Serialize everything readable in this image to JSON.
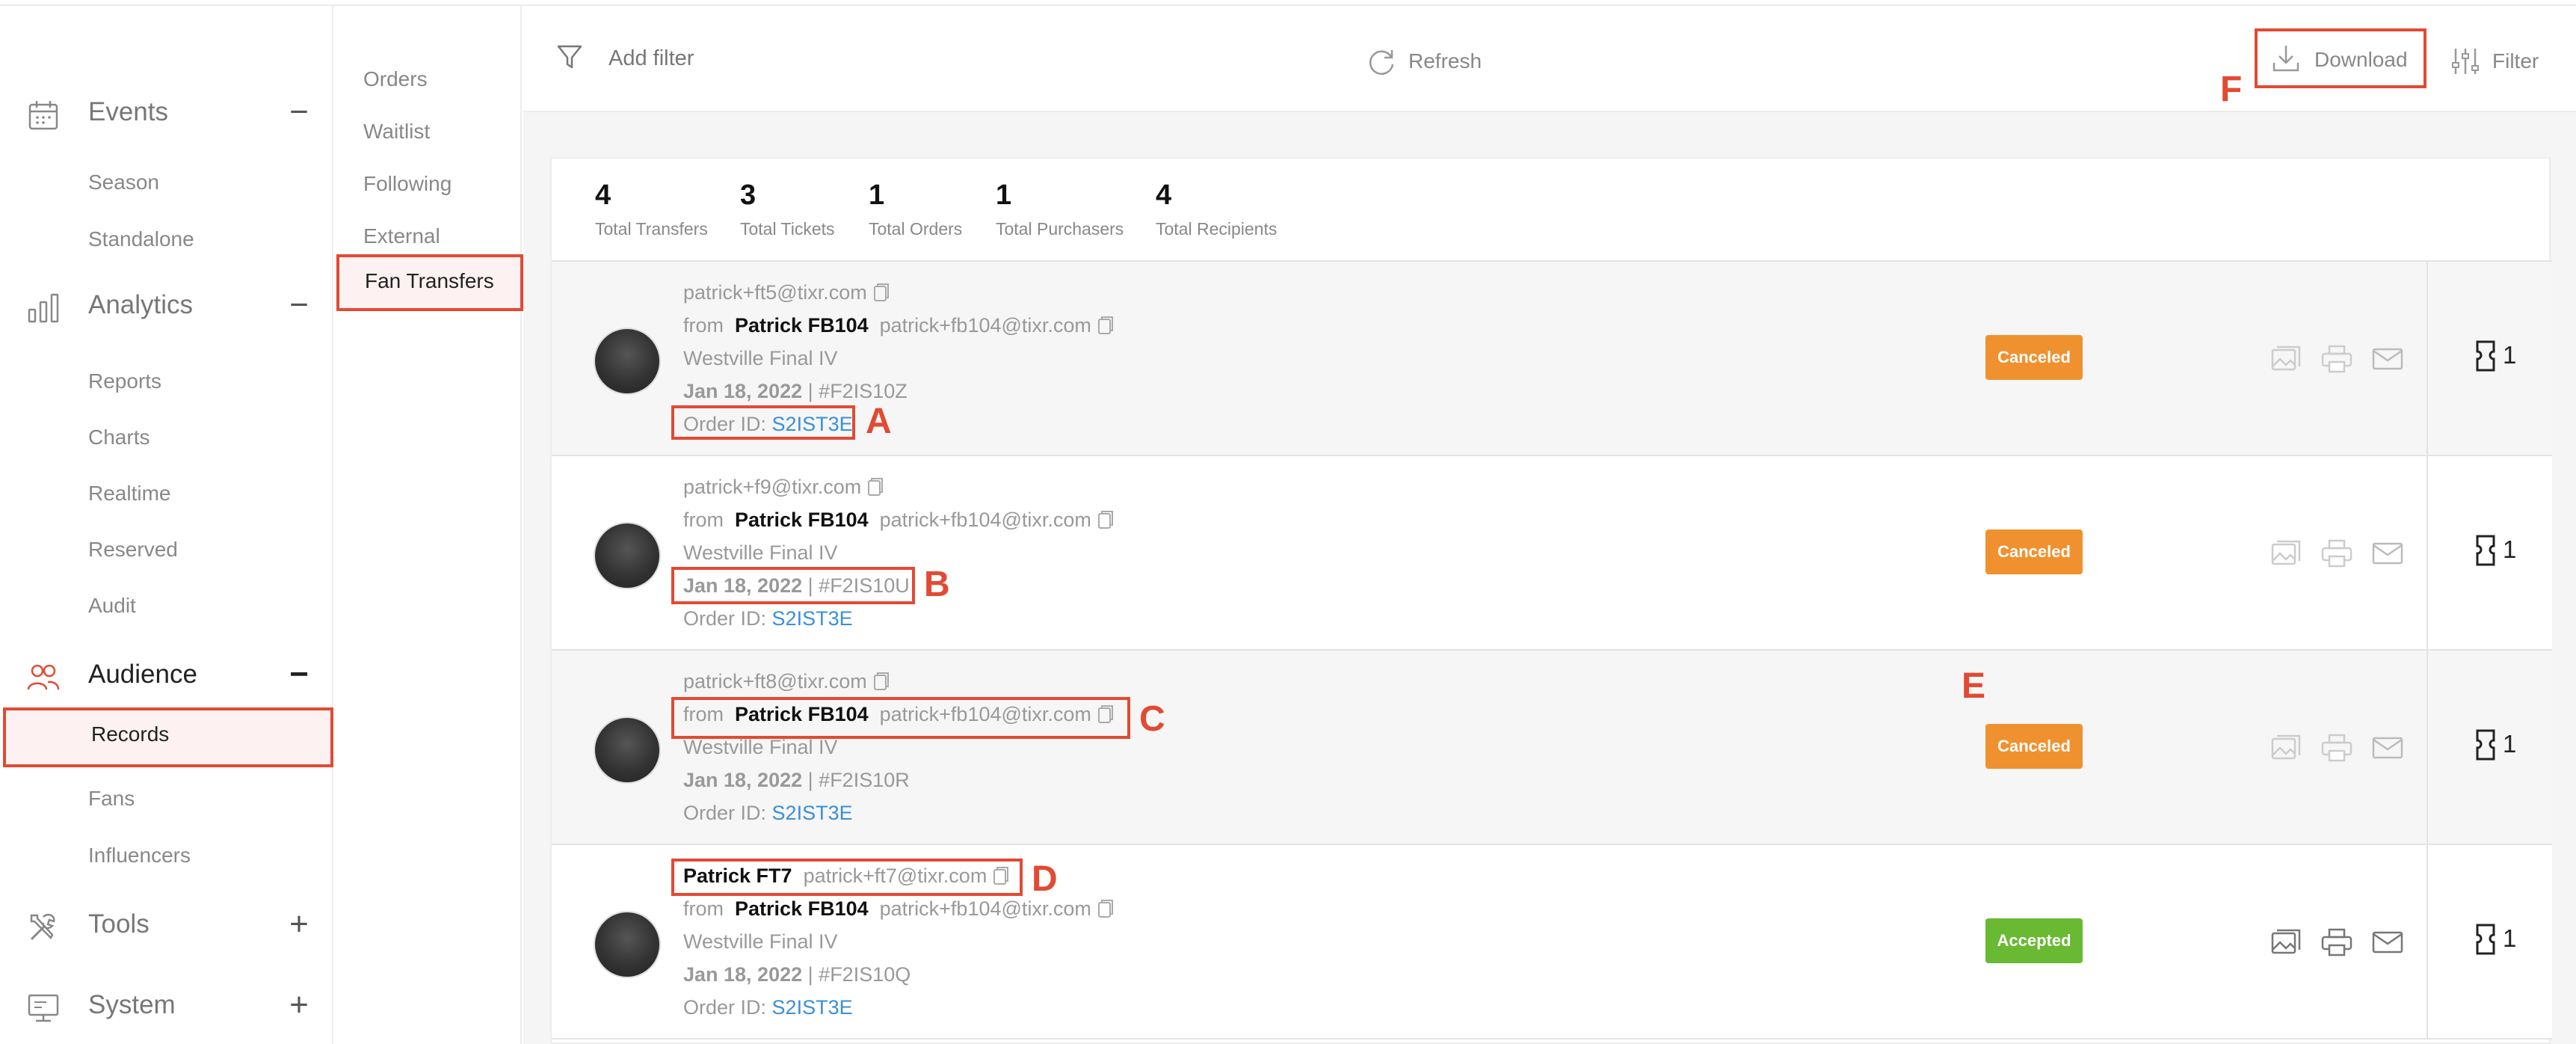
{
  "sidebar": {
    "sections": [
      {
        "label": "Events",
        "icon": "calendar-icon",
        "toggle": "−",
        "items": [
          "Season",
          "Standalone"
        ]
      },
      {
        "label": "Analytics",
        "icon": "bar-chart-icon",
        "toggle": "−",
        "items": [
          "Reports",
          "Charts",
          "Realtime",
          "Reserved",
          "Audit"
        ]
      },
      {
        "label": "Audience",
        "icon": "users-icon",
        "toggle": "−",
        "items": [
          "Records",
          "Fans",
          "Influencers"
        ]
      },
      {
        "label": "Tools",
        "icon": "tools-icon",
        "toggle": "+"
      },
      {
        "label": "System",
        "icon": "monitor-icon",
        "toggle": "+"
      }
    ],
    "selected_item": "Records"
  },
  "subnav": {
    "items": [
      "Orders",
      "Waitlist",
      "Following",
      "External",
      "Fan Transfers"
    ],
    "active": "Fan Transfers"
  },
  "toolbar": {
    "add_filter": "Add filter",
    "refresh": "Refresh",
    "download": "Download",
    "filter": "Filter"
  },
  "stats": [
    {
      "value": "4",
      "label": "Total Transfers"
    },
    {
      "value": "3",
      "label": "Total Tickets"
    },
    {
      "value": "1",
      "label": "Total Orders"
    },
    {
      "value": "1",
      "label": "Total Purchasers"
    },
    {
      "value": "4",
      "label": "Total Recipients"
    }
  ],
  "transfers": [
    {
      "recipient_name": "",
      "recipient_email": "patrick+ft5@tixr.com",
      "from_label": "from",
      "from_name": "Patrick FB104",
      "from_email": "patrick+fb104@tixr.com",
      "event": "Westville Final IV",
      "date": "Jan 18, 2022",
      "ref": "| #F2IS10Z",
      "order_label": "Order ID:",
      "order_id": "S2IST3E",
      "status": "Canceled",
      "tickets": "1"
    },
    {
      "recipient_name": "",
      "recipient_email": "patrick+f9@tixr.com",
      "from_label": "from",
      "from_name": "Patrick FB104",
      "from_email": "patrick+fb104@tixr.com",
      "event": "Westville Final IV",
      "date": "Jan 18, 2022",
      "ref": "| #F2IS10U",
      "order_label": "Order ID:",
      "order_id": "S2IST3E",
      "status": "Canceled",
      "tickets": "1"
    },
    {
      "recipient_name": "",
      "recipient_email": "patrick+ft8@tixr.com",
      "from_label": "from",
      "from_name": "Patrick FB104",
      "from_email": "patrick+fb104@tixr.com",
      "event": "Westville Final IV",
      "date": "Jan 18, 2022",
      "ref": "| #F2IS10R",
      "order_label": "Order ID:",
      "order_id": "S2IST3E",
      "status": "Canceled",
      "tickets": "1"
    },
    {
      "recipient_name": "Patrick FT7",
      "recipient_email": "patrick+ft7@tixr.com",
      "from_label": "from",
      "from_name": "Patrick FB104",
      "from_email": "patrick+fb104@tixr.com",
      "event": "Westville Final IV",
      "date": "Jan 18, 2022",
      "ref": "| #F2IS10Q",
      "order_label": "Order ID:",
      "order_id": "S2IST3E",
      "status": "Accepted",
      "tickets": "1"
    }
  ],
  "annotations": {
    "a": "A",
    "b": "B",
    "c": "C",
    "d": "D",
    "e": "E",
    "f": "F"
  },
  "colors": {
    "accent": "#e24a33",
    "canceled": "#f0912f",
    "accepted": "#69b933",
    "link": "#3a8fd9"
  }
}
